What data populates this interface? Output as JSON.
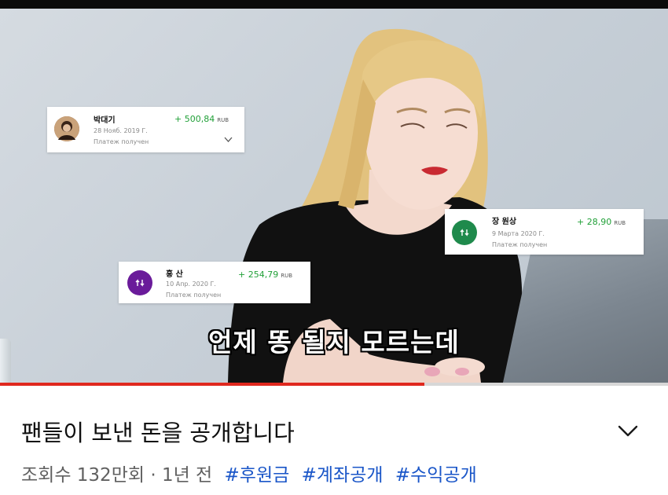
{
  "video": {
    "subtitle": "언제 똥 될지 모르는데",
    "progress_fraction": 0.635
  },
  "payments": [
    {
      "name": "박대기",
      "date": "28 Нояб. 2019 Г.",
      "status": "Платеж получен",
      "amount": "+ 500,84",
      "currency": "RUB",
      "avatar_icon": "profile-photo-icon",
      "avatar_color": "#8a5a3c"
    },
    {
      "name": "장 원상",
      "date": "9 Марта 2020 Г.",
      "status": "Платеж получен",
      "amount": "+ 28,90",
      "currency": "RUB",
      "avatar_icon": "transfer-arrows-icon",
      "avatar_color": "#1f8a4c"
    },
    {
      "name": "홍 산",
      "date": "10 Апр. 2020 Г.",
      "status": "Платеж получен",
      "amount": "+ 254,79",
      "currency": "RUB",
      "avatar_icon": "transfer-arrows-icon",
      "avatar_color": "#6a1b9a"
    }
  ],
  "info": {
    "title": "팬들이 보낸 돈을 공개합니다",
    "views": "조회수 132만회",
    "separator": "·",
    "age": "1년 전",
    "tags": [
      "#후원금",
      "#계좌공개",
      "#수익공개"
    ],
    "expand_icon": "chevron-down-icon"
  },
  "colors": {
    "progress": "#e0281e",
    "hashtag": "#1a56c8",
    "amount": "#21a038"
  }
}
